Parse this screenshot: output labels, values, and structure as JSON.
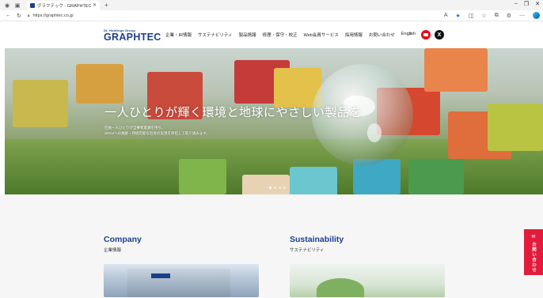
{
  "browser": {
    "tab_title": "グラフテック - GRAPHTEC -",
    "url": "https://graphtec.co.jp",
    "icons": [
      "back-icon",
      "refresh-icon",
      "lock-icon",
      "read-aloud-icon",
      "favorite-star-icon",
      "split-screen-icon",
      "favorites-icon",
      "collections-icon",
      "extensions-icon",
      "more-icon",
      "edge-copilot-icon"
    ]
  },
  "header": {
    "group_text": "DL Holdings Group",
    "brand": "GRAPHTEC",
    "nav": [
      "企業・IR情報",
      "サステナビリティ",
      "製品情報",
      "修理・保守・校正",
      "Web会員サービス",
      "採用情報",
      "お問い合わせ",
      "English"
    ],
    "colors": {
      "brand": "#1b3f8b",
      "youtube": "#e50914",
      "x": "#111111"
    }
  },
  "hero": {
    "headline": "一人ひとりが輝く環境と地球にやさしい製品を",
    "sub_line1": "社員一人ひとりが当事者意識を持ち、",
    "sub_line2": "SDGsへの貢献・持続可能な社会の実現を目指して取り組みます。",
    "slides": 4,
    "active_slide": 1
  },
  "cards": [
    {
      "title": "Company",
      "subtitle": "企業情報"
    },
    {
      "title": "Sustainability",
      "subtitle": "サステナビリティ"
    }
  ],
  "contact_tab": {
    "label": "お問い合わせ",
    "color": "#e21b3c"
  }
}
